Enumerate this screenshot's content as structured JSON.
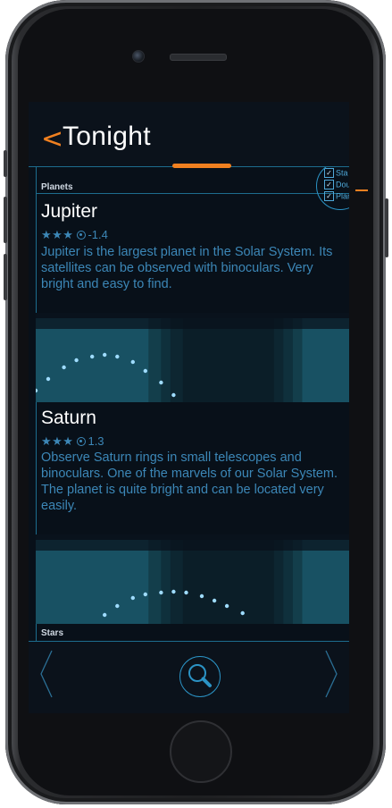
{
  "header": {
    "back_glyph": "<",
    "title": "Tonight"
  },
  "sections": {
    "planets_label": "Planets",
    "stars_label": "Stars"
  },
  "filter": {
    "items": [
      {
        "label": "Sta",
        "checked": true
      },
      {
        "label": "Double",
        "checked": true
      },
      {
        "label": "Planet",
        "checked": true
      }
    ]
  },
  "planets": [
    {
      "name": "Jupiter",
      "stars": "★★★",
      "magnitude": "-1.4",
      "description": "Jupiter is the largest planet in the Solar System. Its satellites can be observed with binoculars. Very bright and easy to find.",
      "visibility_path": [
        [
          0,
          0.87
        ],
        [
          0.04,
          0.74
        ],
        [
          0.09,
          0.61
        ],
        [
          0.13,
          0.53
        ],
        [
          0.18,
          0.49
        ],
        [
          0.22,
          0.47
        ],
        [
          0.26,
          0.49
        ],
        [
          0.31,
          0.55
        ],
        [
          0.35,
          0.65
        ],
        [
          0.4,
          0.78
        ],
        [
          0.44,
          0.92
        ]
      ]
    },
    {
      "name": "Saturn",
      "stars": "★★★",
      "magnitude": "1.3",
      "description": "Observe Saturn rings in small telescopes and binoculars. One of the marvels of our Solar System. The planet is quite bright and can be located very easily.",
      "visibility_path": [
        [
          0.22,
          0.9
        ],
        [
          0.26,
          0.8
        ],
        [
          0.31,
          0.71
        ],
        [
          0.35,
          0.67
        ],
        [
          0.4,
          0.65
        ],
        [
          0.44,
          0.64
        ],
        [
          0.48,
          0.65
        ],
        [
          0.53,
          0.69
        ],
        [
          0.57,
          0.74
        ],
        [
          0.61,
          0.8
        ],
        [
          0.66,
          0.88
        ]
      ]
    }
  ],
  "footer": {
    "prev_icon": "chevron-left-icon",
    "search_icon": "search-icon",
    "next_icon": "chevron-right-icon"
  },
  "colors": {
    "accent": "#f08020",
    "line": "#1d6c8e",
    "text_blue": "#3c87b7",
    "chart_band": "#1b5c6e",
    "background": "#081019"
  }
}
